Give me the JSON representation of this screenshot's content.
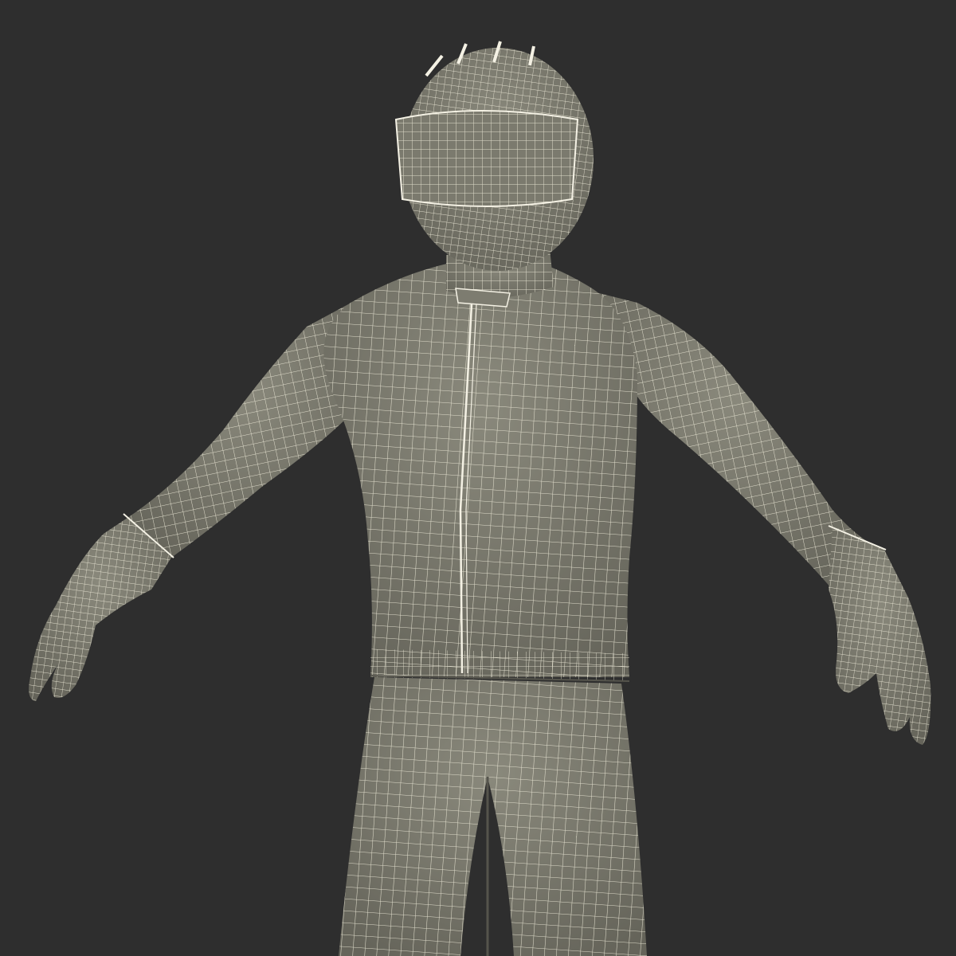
{
  "scene": {
    "subject": "wireframe-figure",
    "colors": {
      "background": "#2e2e2e",
      "surface": "#7d7c70",
      "surface_shadow": "#5f5e55",
      "wire": "#ece8d6",
      "seam": "#f4f1e4"
    }
  }
}
